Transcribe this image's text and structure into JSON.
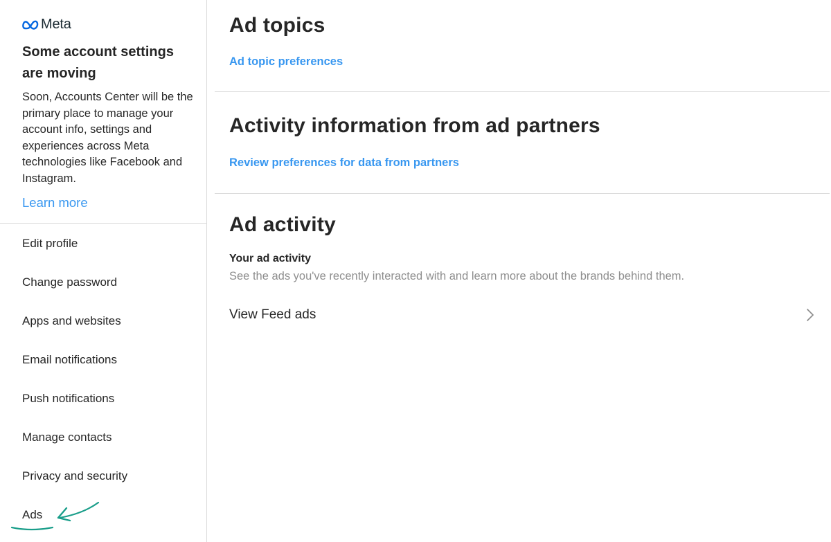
{
  "brand": {
    "name": "Meta"
  },
  "notice": {
    "title": "Some account settings are moving",
    "body": "Soon, Accounts Center will be the primary place to manage your account info, settings and experiences across Meta technologies like Facebook and Instagram.",
    "learn_more": "Learn more"
  },
  "sidebar": {
    "items": [
      {
        "label": "Edit profile"
      },
      {
        "label": "Change password"
      },
      {
        "label": "Apps and websites"
      },
      {
        "label": "Email notifications"
      },
      {
        "label": "Push notifications"
      },
      {
        "label": "Manage contacts"
      },
      {
        "label": "Privacy and security"
      },
      {
        "label": "Ads",
        "selected": true
      }
    ]
  },
  "sections": {
    "ad_topics": {
      "title": "Ad topics",
      "link": "Ad topic preferences"
    },
    "partners": {
      "title": "Activity information from ad partners",
      "link": "Review preferences for data from partners"
    },
    "ad_activity": {
      "title": "Ad activity",
      "subtitle": "Your ad activity",
      "description": "See the ads you've recently interacted with and learn more about the brands behind them.",
      "row_label": "View Feed ads",
      "row_icon": "chevron-right-icon"
    }
  },
  "colors": {
    "link": "#3897f0",
    "annotation": "#1a9e8a",
    "divider": "#dbdbdb"
  }
}
